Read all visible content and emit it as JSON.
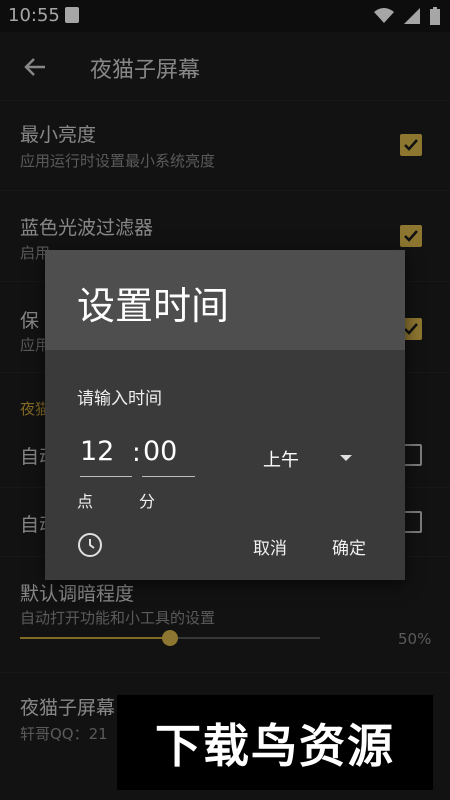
{
  "status": {
    "time": "10:55"
  },
  "app_bar": {
    "title": "夜猫子屏幕"
  },
  "settings": {
    "min_brightness": {
      "title": "最小亮度",
      "subtitle": "应用运行时设置最小系统亮度",
      "checked": true
    },
    "blue_filter": {
      "title": "蓝色光波过滤器",
      "subtitle": "启用",
      "checked": true
    },
    "row3": {
      "title": "保",
      "subtitle": "应用",
      "checked": true
    },
    "section_header": "夜猫",
    "auto1": {
      "title": "自动",
      "checked": false
    },
    "auto2": {
      "title": "自动",
      "checked": false
    },
    "dim": {
      "title": "默认调暗程度",
      "subtitle": "自动打开功能和小工具的设置",
      "value_label": "50%",
      "value": 0.5
    },
    "about": {
      "title": "夜猫子屏幕",
      "subtitle": "轩哥QQ：21"
    }
  },
  "dialog": {
    "title": "设置时间",
    "prompt": "请输入时间",
    "hour": "12",
    "colon": ":",
    "minute": "00",
    "hour_unit": "点",
    "minute_unit": "分",
    "ampm": "上午",
    "cancel": "取消",
    "confirm": "确定"
  },
  "watermark": "下载鸟资源",
  "colors": {
    "accent": "#d9b64a",
    "background": "#1c1c1c",
    "dialog": "#3a3a3a"
  }
}
